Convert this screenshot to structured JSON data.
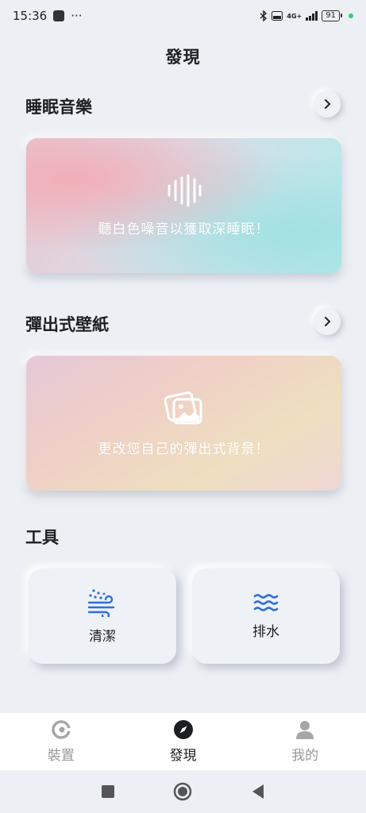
{
  "status_bar": {
    "time": "15:36",
    "more": "···",
    "network_label": "4G+",
    "battery": "91"
  },
  "page_title": "發現",
  "sections": {
    "sleep_music": {
      "title": "睡眠音樂",
      "card_text": "聽白色噪音以獲取深睡眠！"
    },
    "popup_wallpaper": {
      "title": "彈出式壁紙",
      "card_text": "更改您自己的彈出式背景！"
    },
    "tools": {
      "title": "工具",
      "items": [
        {
          "label": "清潔",
          "icon": "cleaning-wind-icon"
        },
        {
          "label": "排水",
          "icon": "water-waves-icon"
        }
      ]
    }
  },
  "bottom_nav": {
    "items": [
      {
        "label": "裝置",
        "icon": "device-icon"
      },
      {
        "label": "發現",
        "icon": "compass-icon",
        "active": true
      },
      {
        "label": "我的",
        "icon": "person-icon"
      }
    ]
  },
  "colors": {
    "accent_blue": "#2f6fd6",
    "background": "#eceff3",
    "nav_inactive": "#999999"
  }
}
